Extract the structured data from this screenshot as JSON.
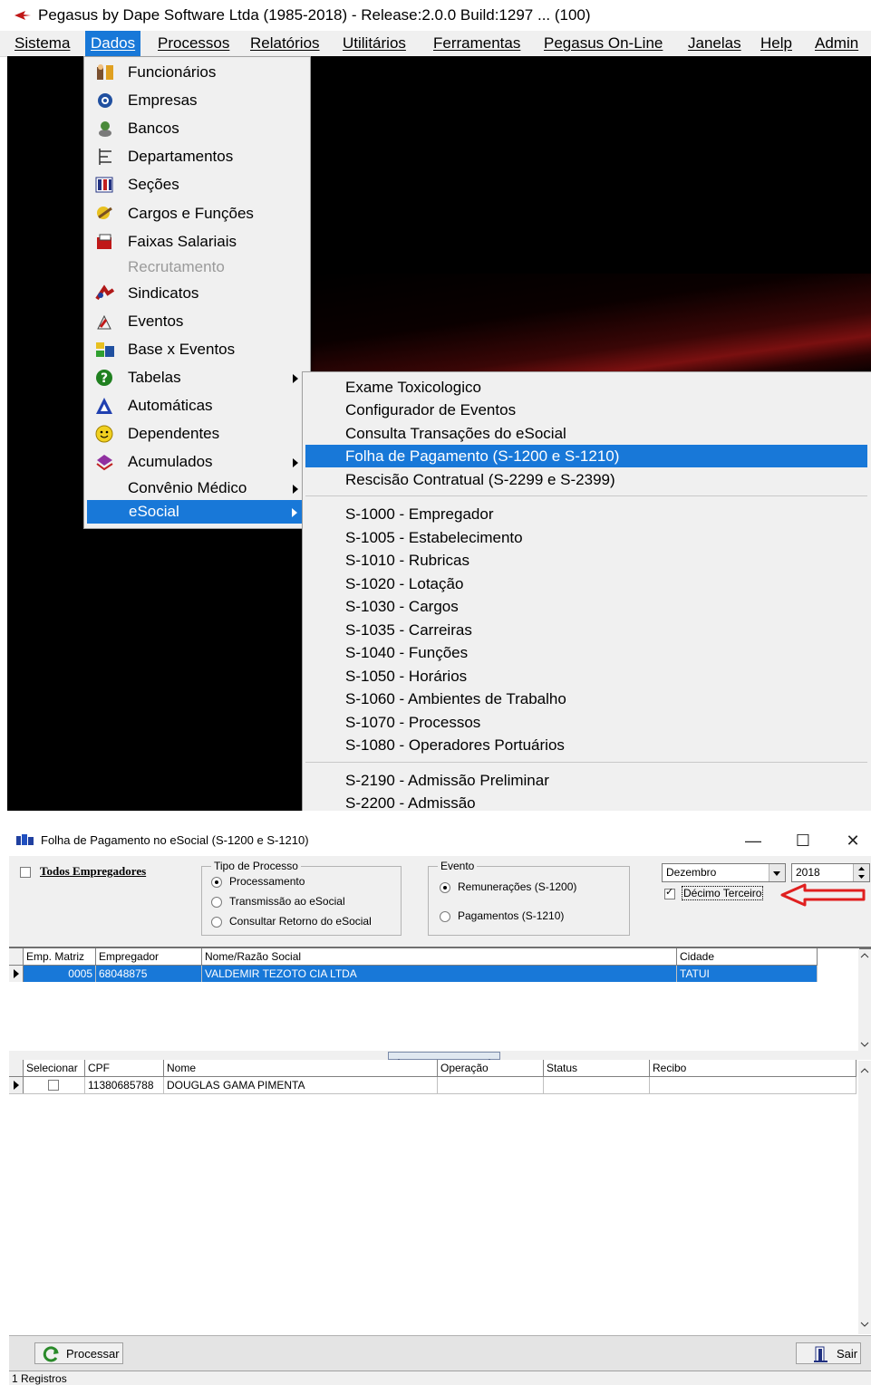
{
  "top": {
    "app_title": "Pegasus by Dape Software Ltda (1985-2018) - Release:2.0.0  Build:1297 ... (100)",
    "menubar": [
      "Sistema",
      "Dados",
      "Processos",
      "Relatórios",
      "Utilitários",
      "Ferramentas",
      "Pegasus On-Line",
      "Janelas",
      "Help",
      "Admin"
    ],
    "active_menu": "Dados",
    "dados_menu": [
      {
        "label": "Funcionários",
        "icon": "employees-icon"
      },
      {
        "label": "Empresas",
        "icon": "company-icon"
      },
      {
        "label": "Bancos",
        "icon": "bank-icon"
      },
      {
        "label": "Departamentos",
        "icon": "department-icon"
      },
      {
        "label": "Seções",
        "icon": "sections-icon"
      },
      {
        "label": "Cargos e Funções",
        "icon": "roles-icon"
      },
      {
        "label": "Faixas Salariais",
        "icon": "salary-icon"
      },
      {
        "label": "Recrutamento",
        "icon": "",
        "disabled": true
      },
      {
        "label": "Sindicatos",
        "icon": "union-icon"
      },
      {
        "label": "Eventos",
        "icon": "events-icon"
      },
      {
        "label": "Base x Eventos",
        "icon": "base-events-icon"
      },
      {
        "label": "Tabelas",
        "icon": "help-tables-icon",
        "submenu": true
      },
      {
        "label": "Automáticas",
        "icon": "auto-icon"
      },
      {
        "label": "Dependentes",
        "icon": "smiley-icon"
      },
      {
        "label": "Acumulados",
        "icon": "accumulated-icon",
        "submenu": true
      },
      {
        "label": "Convênio Médico",
        "icon": "",
        "submenu": true
      },
      {
        "label": "eSocial",
        "icon": "",
        "submenu": true,
        "selected": true
      }
    ],
    "esocial_menu_group1": [
      "Exame Toxicologico",
      "Configurador de Eventos",
      "Consulta Transações do eSocial",
      "Folha de Pagamento (S-1200 e S-1210)",
      "Rescisão Contratual (S-2299 e S-2399)"
    ],
    "esocial_selected": "Folha de Pagamento (S-1200 e S-1210)",
    "esocial_menu_group2": [
      "S-1000 - Empregador",
      "S-1005 - Estabelecimento",
      "S-1010 - Rubricas",
      "S-1020 - Lotação",
      "S-1030 - Cargos",
      "S-1035 - Carreiras",
      "S-1040 - Funções",
      "S-1050 - Horários",
      "S-1060 - Ambientes de Trabalho",
      "S-1070 - Processos",
      "S-1080 - Operadores Portuários"
    ],
    "esocial_menu_group3": [
      "S-2190 - Admissão Preliminar",
      "S-2200 - Admissão"
    ]
  },
  "win": {
    "title": "Folha de Pagamento no eSocial (S-1200 e S-1210)",
    "controls": {
      "minimize": "—",
      "maximize": "☐",
      "close": "✕"
    },
    "todos_empregadores": "Todos Empregadores",
    "tipo_processo": {
      "legend": "Tipo de Processo",
      "options": [
        "Processamento",
        "Transmissão ao eSocial",
        "Consultar Retorno do eSocial"
      ],
      "selected": 0
    },
    "evento": {
      "legend": "Evento",
      "options": [
        "Remunerações (S-1200)",
        "Pagamentos (S-1210)"
      ],
      "selected": 0
    },
    "month": "Dezembro",
    "year": "2018",
    "decimo_terceiro": {
      "label": "Décimo Terceiro",
      "checked": true
    },
    "employers_grid": {
      "columns": [
        "Emp. Matriz",
        "Empregador",
        "Nome/Razão Social",
        "Cidade"
      ],
      "rows": [
        [
          "0005",
          "68048875",
          "VALDEMIR TEZOTO CIA LTDA",
          "TATUI"
        ]
      ]
    },
    "employees_grid": {
      "columns": [
        "Selecionar",
        "CPF",
        "Nome",
        "Operação",
        "Status",
        "Recibo"
      ],
      "rows": [
        [
          "",
          "11380685788",
          "DOUGLAS GAMA PIMENTA",
          "",
          "",
          ""
        ]
      ]
    },
    "btn_processar": "Processar",
    "btn_sair": "Sair",
    "status": "1 Registros",
    "accent": "#1878d8",
    "arrow_color": "#e02020"
  }
}
